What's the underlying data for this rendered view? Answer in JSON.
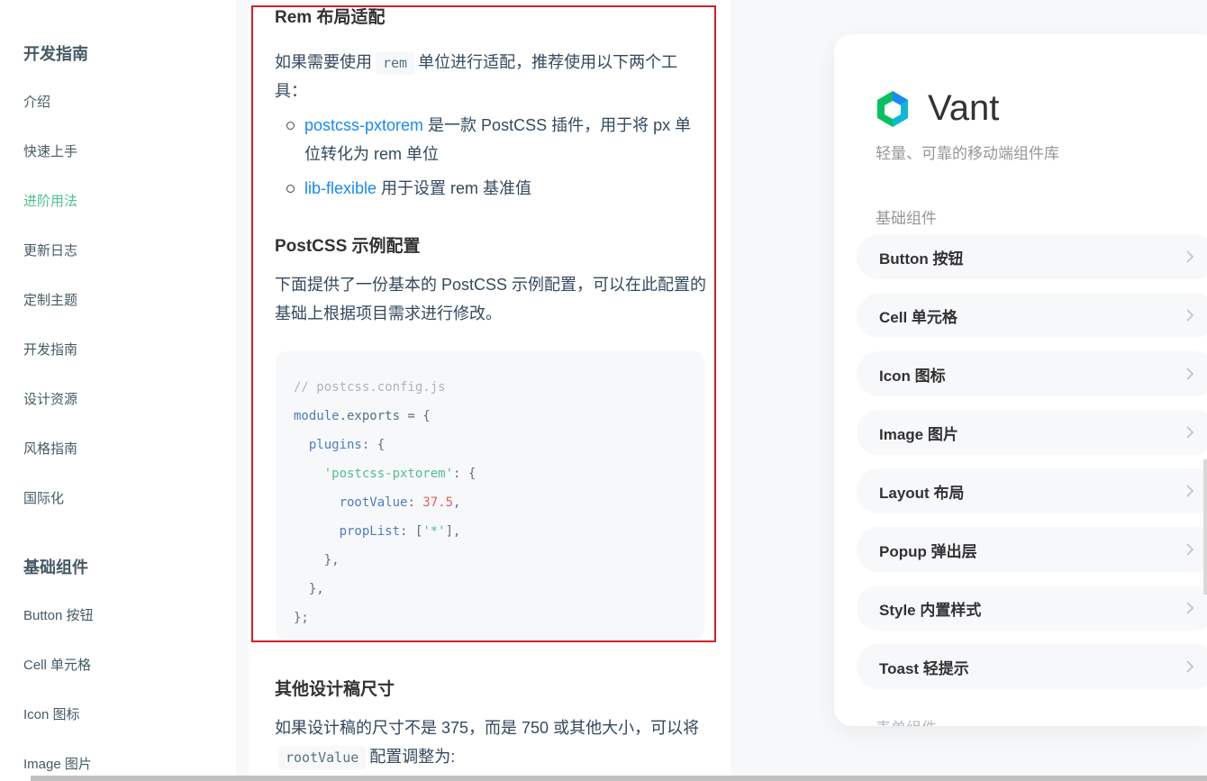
{
  "sidebar": {
    "group1_title": "开发指南",
    "items1": [
      "介绍",
      "快速上手",
      "进阶用法",
      "更新日志",
      "定制主题",
      "开发指南",
      "设计资源",
      "风格指南",
      "国际化"
    ],
    "active_item": "进阶用法",
    "group2_title": "基础组件",
    "items2": [
      "Button 按钮",
      "Cell 单元格",
      "Icon 图标",
      "Image 图片"
    ]
  },
  "doc": {
    "heading_rem": "Rem 布局适配",
    "p1_before": "如果需要使用",
    "p1_code": "rem",
    "p1_after": "单位进行适配，推荐使用以下两个工具：",
    "li1_link": "postcss-pxtorem",
    "li1_text": " 是一款 PostCSS 插件，用于将 px 单位转化为 rem 单位",
    "li2_link": "lib-flexible",
    "li2_text": " 用于设置 rem 基准值",
    "heading_postcss": "PostCSS 示例配置",
    "p2": "下面提供了一份基本的 PostCSS 示例配置，可以在此配置的基础上根据项目需求进行修改。",
    "code": {
      "comment": "// postcss.config.js",
      "module": "module",
      "exports": ".exports = {",
      "plugins": "plugins",
      "plugins_rest": ": {",
      "pxtorem_str": "'postcss-pxtorem'",
      "pxtorem_rest": ": {",
      "rootValue_key": "rootValue",
      "rootValue_val": "37.5",
      "propList_key": "propList",
      "propList_open": ": [",
      "propList_str": "'*'",
      "propList_close": "],",
      "close1": "},",
      "close2": "},",
      "close3": "};"
    },
    "heading_other": "其他设计稿尺寸",
    "p3_before": "如果设计稿的尺寸不是 375，而是 750 或其他大小，可以将",
    "p3_code": "rootValue",
    "p3_after": "配置调整为:"
  },
  "simulator": {
    "brand": "Vant",
    "tagline": "轻量、可靠的移动端组件库",
    "group_title": "基础组件",
    "items": [
      "Button 按钮",
      "Cell 单元格",
      "Icon 图标",
      "Image 图片",
      "Layout 布局",
      "Popup 弹出层",
      "Style 内置样式",
      "Toast 轻提示"
    ],
    "next_group_title": "表单组件"
  },
  "colors": {
    "accent": "#4fc08d",
    "link": "#1989fa",
    "highlight_box": "#d0202a"
  },
  "icons": [
    "vant-logo-icon",
    "chevron-right-icon"
  ]
}
